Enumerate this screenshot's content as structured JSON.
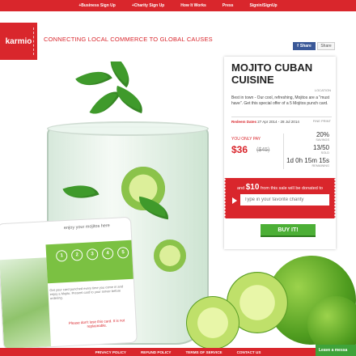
{
  "topnav": {
    "links": [
      "+Business Sign Up",
      "+Charity Sign Up",
      "How It Works",
      "Press",
      "Signin/SignUp"
    ]
  },
  "header": {
    "logo_text": "karmio",
    "tagline": "CONNECTING LOCAL COMMERCE TO GLOBAL CAUSES"
  },
  "share": {
    "facebook": "Share",
    "share": "Share"
  },
  "deal": {
    "title": "MOJITO CUBAN CUISINE",
    "location_label": "LOCATION",
    "description": "Best in town - Our cool, refreshing, Mojitos are a \"must have\". Get this special offer of a 5 Mojitos punch card.",
    "dates_label": "Redeem Dates",
    "dates_value": "27 Apr 2014 - 28 Jul 2014",
    "fine_print": "FINE PRINT",
    "you_only_pay": "YOU ONLY PAY",
    "price": "$36",
    "old_price": "($45)",
    "savings_value": "20%",
    "savings_label": "SAVINGS",
    "sold_value": "13/50",
    "sold_label": "SOLD",
    "remaining_value": "1d 0h 15m 15s",
    "remaining_label": "REMAINING",
    "donate_prefix": "and",
    "donate_amount": "$10",
    "donate_suffix": "from this sale will be donated to",
    "charity_placeholder": "Type in your favorite charity",
    "buy_label": "BUY IT!"
  },
  "card": {
    "title": "enjoy your mojitos here",
    "circles": [
      "1",
      "2",
      "3",
      "4",
      "5"
    ],
    "fine": "Get your card punched every time you come in and enjoy a Mojito. Present card to your server before ordering.",
    "note": "Please don't lose this card. It is not replaceable."
  },
  "footer": {
    "links": [
      "PRIVACY POLICY",
      "REFUND POLICY",
      "TERMS OF SERVICE",
      "CONTACT US"
    ]
  },
  "chat": {
    "label": "Leave a messa"
  },
  "colors": {
    "brand_red": "#d9262c",
    "buy_green": "#4caf36",
    "card_green": "#7bc142"
  }
}
